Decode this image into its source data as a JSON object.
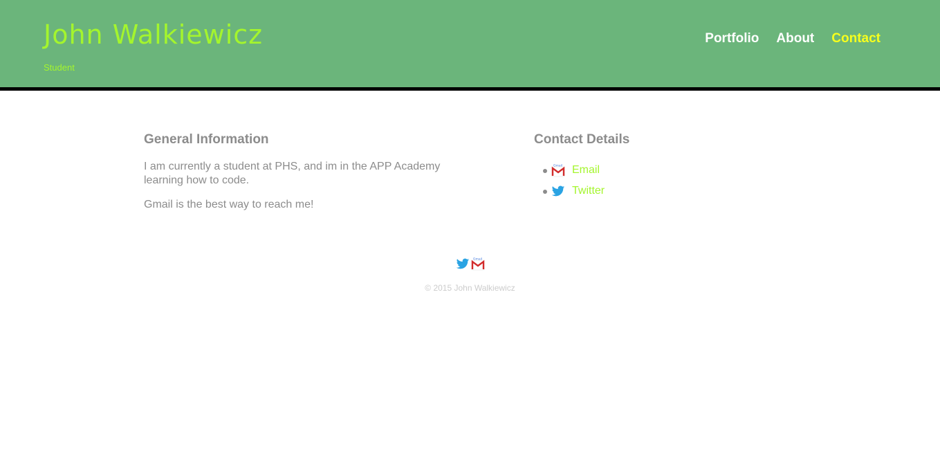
{
  "header": {
    "title": "John Walkiewicz",
    "subtitle": "Student",
    "colors": {
      "background": "#6bb57b",
      "title": "#a4f52d",
      "nav": "#ffffff",
      "nav_active": "#f7ff1d"
    }
  },
  "nav": {
    "items": [
      {
        "label": "Portfolio",
        "active": false
      },
      {
        "label": "About",
        "active": false
      },
      {
        "label": "Contact",
        "active": true
      }
    ]
  },
  "general": {
    "heading": "General Information",
    "paragraphs": [
      "I am currently a student at PHS, and im in the APP Academy learning how to code.",
      "Gmail is the best way to reach me!"
    ]
  },
  "contact": {
    "heading": "Contact Details",
    "items": [
      {
        "icon": "gmail-icon",
        "label": "Email"
      },
      {
        "icon": "twitter-icon",
        "label": "Twitter"
      }
    ]
  },
  "footer": {
    "icons": [
      "twitter-icon",
      "gmail-icon"
    ],
    "copyright": "© 2015 John Walkiewicz"
  }
}
